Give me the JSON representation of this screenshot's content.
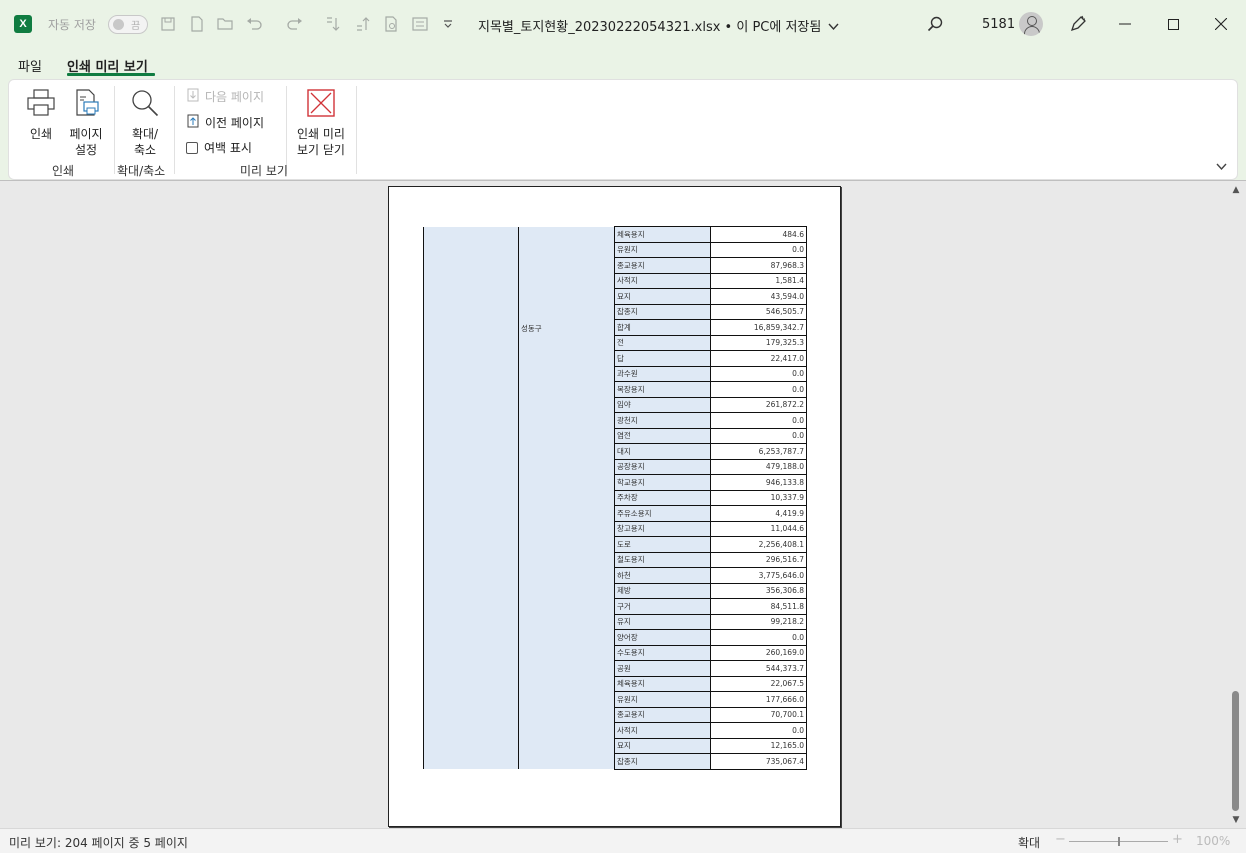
{
  "titlebar": {
    "app_logo": "X",
    "autosave_label": "자동 저장",
    "autosave_state": "끔",
    "document_title": "지목별_토지현황_20230222054321.xlsx • 이 PC에 저장됨",
    "user_number": "5181"
  },
  "menu": {
    "tabs": [
      {
        "label": "파일"
      },
      {
        "label": "인쇄 미리 보기"
      }
    ]
  },
  "ribbon": {
    "print_label": "인쇄",
    "page_setup_label1": "페이지",
    "page_setup_label2": "설정",
    "zoom_label1": "확대/",
    "zoom_label2": "축소",
    "next_page_label": "다음 페이지",
    "prev_page_label": "이전 페이지",
    "show_margins_label": "여백 표시",
    "close_label1": "인쇄 미리",
    "close_label2": "보기 닫기",
    "groups": {
      "print": "인쇄",
      "zoom": "확대/축소",
      "preview": "미리 보기"
    }
  },
  "table": {
    "district_label": "성동구",
    "rows": [
      {
        "type": "체육용지",
        "value": "484.6"
      },
      {
        "type": "유원지",
        "value": "0.0"
      },
      {
        "type": "종교용지",
        "value": "87,968.3"
      },
      {
        "type": "사적지",
        "value": "1,581.4"
      },
      {
        "type": "묘지",
        "value": "43,594.0"
      },
      {
        "type": "잡종지",
        "value": "546,505.7"
      },
      {
        "type": "합계",
        "value": "16,859,342.7"
      },
      {
        "type": "전",
        "value": "179,325.3"
      },
      {
        "type": "답",
        "value": "22,417.0"
      },
      {
        "type": "과수원",
        "value": "0.0"
      },
      {
        "type": "목장용지",
        "value": "0.0"
      },
      {
        "type": "임야",
        "value": "261,872.2"
      },
      {
        "type": "광천지",
        "value": "0.0"
      },
      {
        "type": "염전",
        "value": "0.0"
      },
      {
        "type": "대지",
        "value": "6,253,787.7"
      },
      {
        "type": "공장용지",
        "value": "479,188.0"
      },
      {
        "type": "학교용지",
        "value": "946,133.8"
      },
      {
        "type": "주차장",
        "value": "10,337.9"
      },
      {
        "type": "주유소용지",
        "value": "4,419.9"
      },
      {
        "type": "창고용지",
        "value": "11,044.6"
      },
      {
        "type": "도로",
        "value": "2,256,408.1"
      },
      {
        "type": "철도용지",
        "value": "296,516.7"
      },
      {
        "type": "하천",
        "value": "3,775,646.0"
      },
      {
        "type": "제방",
        "value": "356,306.8"
      },
      {
        "type": "구거",
        "value": "84,511.8"
      },
      {
        "type": "유지",
        "value": "99,218.2"
      },
      {
        "type": "양어장",
        "value": "0.0"
      },
      {
        "type": "수도용지",
        "value": "260,169.0"
      },
      {
        "type": "공원",
        "value": "544,373.7"
      },
      {
        "type": "체육용지",
        "value": "22,067.5"
      },
      {
        "type": "유원지",
        "value": "177,666.0"
      },
      {
        "type": "종교용지",
        "value": "70,700.1"
      },
      {
        "type": "사적지",
        "value": "0.0"
      },
      {
        "type": "묘지",
        "value": "12,165.0"
      },
      {
        "type": "잡종지",
        "value": "735,067.4"
      }
    ]
  },
  "statusbar": {
    "page_info": "미리 보기: 204 페이지 중 5 페이지",
    "zoom_label": "확대",
    "zoom_minus": "−",
    "zoom_plus": "+",
    "zoom_value": "100%"
  }
}
